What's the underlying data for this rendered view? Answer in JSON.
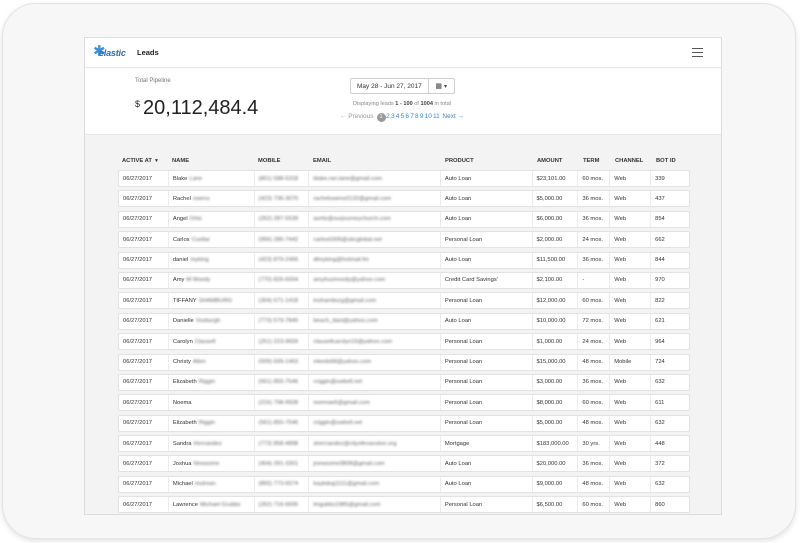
{
  "app": {
    "logo_text": "elastic",
    "page_title": "Leads"
  },
  "summary": {
    "pipeline_label": "Total Pipeline",
    "currency": "$",
    "pipeline_value": "20,112,484.4",
    "date_range": "May 28 - Jun 27, 2017",
    "displaying_prefix": "Displaying leads ",
    "displaying_range": "1 - 100",
    "displaying_of": " of ",
    "displaying_total": "1004",
    "displaying_suffix": " in total"
  },
  "pagination": {
    "prev": "← Previous",
    "current": "1",
    "pages": [
      "2",
      "3",
      "4",
      "5",
      "6",
      "7",
      "8",
      "9",
      "10",
      "11"
    ],
    "next": "Next →"
  },
  "table": {
    "headers": [
      "ACTIVE AT",
      "NAME",
      "MOBILE",
      "EMAIL",
      "PRODUCT",
      "AMOUNT",
      "TERM",
      "CHANNEL",
      "BOT ID"
    ],
    "rows": [
      {
        "date": "06/27/2017",
        "first": "Blake",
        "last": "Lane",
        "mobile": "(801) 588-5318",
        "email": "blake.ran.lane@gmail.com",
        "product": "Auto Loan",
        "amount": "$23,101.00",
        "term": "60 mos.",
        "channel": "Web",
        "bot": "339"
      },
      {
        "date": "06/27/2017",
        "first": "Rachel",
        "last": "owens",
        "mobile": "(423) 736-3070",
        "email": "rachelowens0132@gmail.com",
        "product": "Auto Loan",
        "amount": "$5,000.00",
        "term": "36 mos.",
        "channel": "Web",
        "bot": "437"
      },
      {
        "date": "06/27/2017",
        "first": "Angel",
        "last": "Ortiz",
        "mobile": "(262) 287-5539",
        "email": "aortiz@ourjourneychurch.com",
        "product": "Auto Loan",
        "amount": "$6,000.00",
        "term": "36 mos.",
        "channel": "Web",
        "bot": "854"
      },
      {
        "date": "06/27/2017",
        "first": "Carlos",
        "last": "Cuellar",
        "mobile": "(956) 286-7442",
        "email": "carlos0306@sbcglobal.net",
        "product": "Personal Loan",
        "amount": "$2,000.00",
        "term": "24 mos.",
        "channel": "Web",
        "bot": "662"
      },
      {
        "date": "06/27/2017",
        "first": "daniel",
        "last": "myking",
        "mobile": "(423) 879-2466",
        "email": "dlmyking@hotmail.fm",
        "product": "Auto Loan",
        "amount": "$11,500.00",
        "term": "36 mos.",
        "channel": "Web",
        "bot": "844"
      },
      {
        "date": "06/27/2017",
        "first": "Amy",
        "last": "M Moody",
        "mobile": "(770) 826-6004",
        "email": "amyhusmoody@yahoo.com",
        "product": "Credit Card Savings'",
        "amount": "$2,100.00",
        "term": "-",
        "channel": "Web",
        "bot": "970"
      },
      {
        "date": "06/27/2017",
        "first": "TIFFANY",
        "last": "SHAMBURG",
        "mobile": "(304) 671-1418",
        "email": "tnshamburg@gmail.com",
        "product": "Personal Loan",
        "amount": "$12,000.00",
        "term": "60 mos.",
        "channel": "Web",
        "bot": "822"
      },
      {
        "date": "06/27/2017",
        "first": "Danielle",
        "last": "Vosburgh",
        "mobile": "(773) 579-7845",
        "email": "beach_dani@yahoo.com",
        "product": "Auto Loan",
        "amount": "$10,000.00",
        "term": "72 mos.",
        "channel": "Web",
        "bot": "621"
      },
      {
        "date": "06/27/2017",
        "first": "Carolyn",
        "last": "Clausell",
        "mobile": "(251) 223-9659",
        "email": "clausellcarolyn15@yahoo.com",
        "product": "Personal Loan",
        "amount": "$1,000.00",
        "term": "24 mos.",
        "channel": "Web",
        "bot": "964"
      },
      {
        "date": "06/27/2017",
        "first": "Christy",
        "last": "Allen",
        "mobile": "(509) 699-1463",
        "email": "mkeds68@yahoo.com",
        "product": "Personal Loan",
        "amount": "$15,000.00",
        "term": "48 mos.",
        "channel": "Mobile",
        "bot": "724"
      },
      {
        "date": "06/27/2017",
        "first": "Elizabeth",
        "last": "Riggin",
        "mobile": "(561) 855-7546",
        "email": "criggin@swbell.net",
        "product": "Personal Loan",
        "amount": "$3,000.00",
        "term": "36 mos.",
        "channel": "Web",
        "bot": "632"
      },
      {
        "date": "06/27/2017",
        "first": "Noema",
        "last": "",
        "mobile": "(216) 798-9928",
        "email": "noemae6@gmail.com",
        "product": "Personal Loan",
        "amount": "$8,000.00",
        "term": "60 mos.",
        "channel": "Web",
        "bot": "611"
      },
      {
        "date": "06/27/2017",
        "first": "Elizabeth",
        "last": "Riggin",
        "mobile": "(561) 855-7546",
        "email": "criggin@swbell.net",
        "product": "Personal Loan",
        "amount": "$5,000.00",
        "term": "48 mos.",
        "channel": "Web",
        "bot": "632"
      },
      {
        "date": "06/27/2017",
        "first": "Sandra",
        "last": "Hernandez",
        "mobile": "(773) 858-4898",
        "email": "shernandez@cityofevanston.org",
        "product": "Mortgage",
        "amount": "$183,000.00",
        "term": "30 yrs.",
        "channel": "Web",
        "bot": "448"
      },
      {
        "date": "06/27/2017",
        "first": "Joshua",
        "last": "Newsome",
        "mobile": "(404) 391-3301",
        "email": "jnewsome3808@gmail.com",
        "product": "Auto Loan",
        "amount": "$20,000.00",
        "term": "36 mos.",
        "channel": "Web",
        "bot": "372"
      },
      {
        "date": "06/27/2017",
        "first": "Michael",
        "last": "mulrean",
        "mobile": "(865) 773-6574",
        "email": "kaybdog1111@gmail.com",
        "product": "Auto Loan",
        "amount": "$9,000.00",
        "term": "48 mos.",
        "channel": "Web",
        "bot": "632"
      },
      {
        "date": "06/27/2017",
        "first": "Lawrence",
        "last": "Michael Grubbs",
        "mobile": "(262) 716-6695",
        "email": "lmgubbs1985@gmail.com",
        "product": "Personal Loan",
        "amount": "$6,500.00",
        "term": "60 mos.",
        "channel": "Web",
        "bot": "860"
      }
    ]
  },
  "colors": {
    "accent": "#3b84c8",
    "pager_current": "#9a9a9a"
  },
  "icons": {
    "menu": "hamburger-icon",
    "calendar": "calendar-icon",
    "sort": "sort-down-icon"
  }
}
